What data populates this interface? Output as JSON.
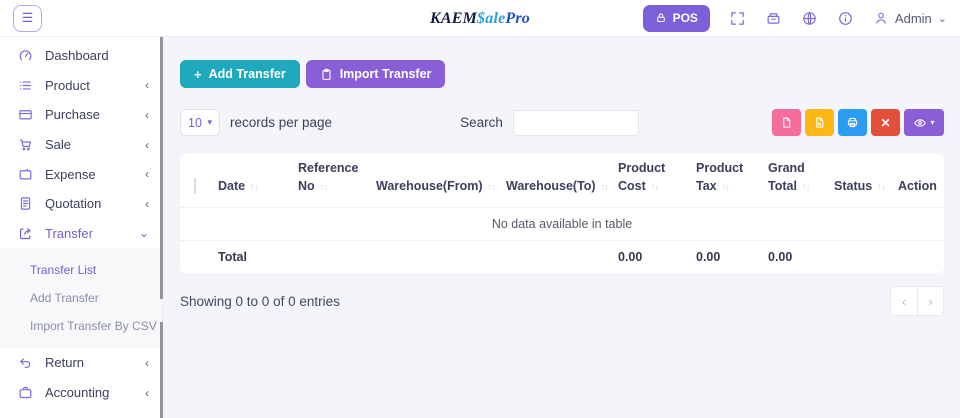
{
  "topbar": {
    "logo_kaem": "KAEM",
    "logo_sale": "$ale",
    "logo_pro": "Pro",
    "pos_label": "POS",
    "admin_label": "Admin"
  },
  "sidebar": {
    "items": [
      {
        "label": "Dashboard"
      },
      {
        "label": "Product"
      },
      {
        "label": "Purchase"
      },
      {
        "label": "Sale"
      },
      {
        "label": "Expense"
      },
      {
        "label": "Quotation"
      },
      {
        "label": "Transfer"
      },
      {
        "label": "Return"
      },
      {
        "label": "Accounting"
      }
    ],
    "submenu": [
      {
        "label": "Transfer List"
      },
      {
        "label": "Add Transfer"
      },
      {
        "label": "Import Transfer By CSV"
      }
    ]
  },
  "toolbar": {
    "add_label": "Add Transfer",
    "import_label": "Import Transfer"
  },
  "controls": {
    "page_size": "10",
    "records_label": "records per page",
    "search_label": "Search",
    "search_value": ""
  },
  "table": {
    "columns": [
      "Date",
      "Reference No",
      "Warehouse(From)",
      "Warehouse(To)",
      "Product Cost",
      "Product Tax",
      "Grand Total",
      "Status",
      "Action"
    ],
    "empty_message": "No data available in table",
    "total": {
      "label": "Total",
      "product_cost": "0.00",
      "product_tax": "0.00",
      "grand_total": "0.00"
    }
  },
  "footer": {
    "showing": "Showing 0 to 0 of 0 entries"
  },
  "icons": {
    "hamburger": "☰",
    "plus": "+",
    "close": "✕",
    "caret_down": "▾",
    "chevron_collapsed": "‹",
    "chevron_expanded": "⌄",
    "sort": "↑↓",
    "prev": "‹",
    "next": "›"
  },
  "colors": {
    "accent_purple": "#7c60d9",
    "active_link": "#7a5dd0",
    "add_teal": "#1fa9bc",
    "import_purple": "#8a5ed6",
    "pdf_pink": "#f66d9b",
    "export_yellow": "#fcb916",
    "print_blue": "#2b9cf2",
    "close_red": "#e2503c",
    "logo_blue": "#2e9fd6",
    "logo_dark_blue": "#1d50c8"
  }
}
